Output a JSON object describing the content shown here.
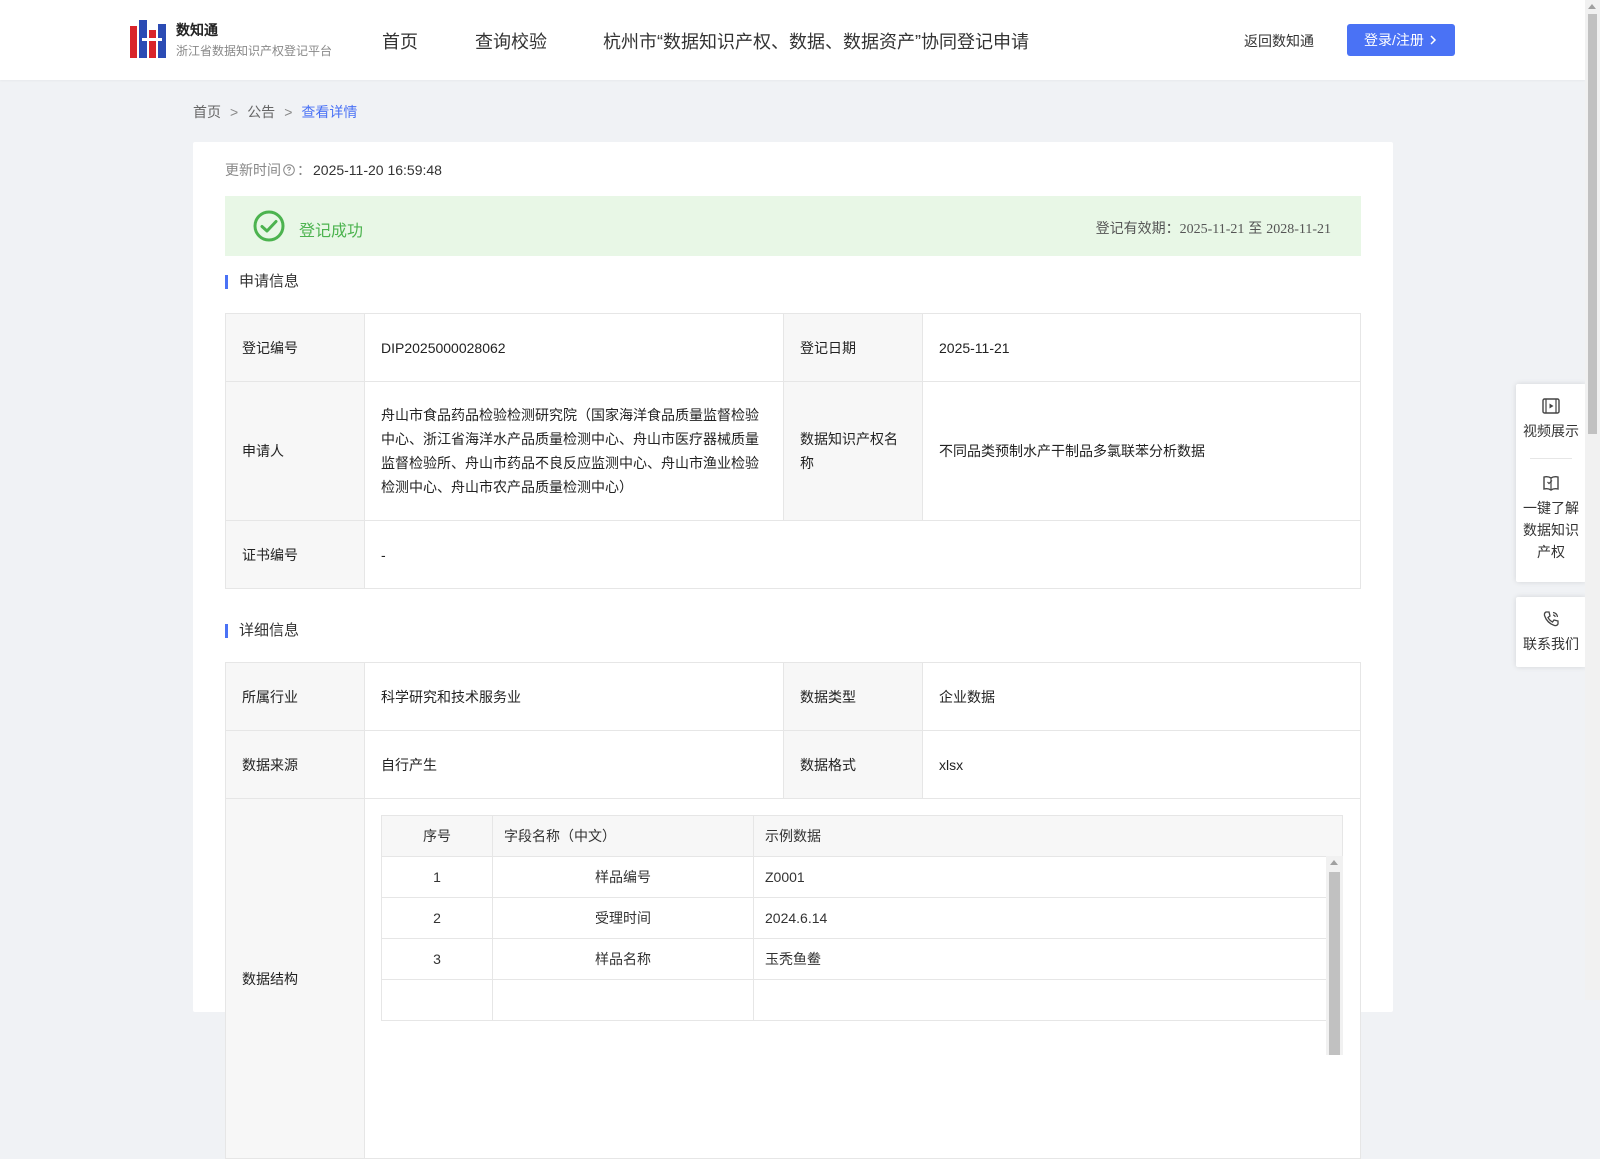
{
  "header": {
    "brand_name": "数知通",
    "brand_sub": "浙江省数据知识产权登记平台",
    "nav": [
      {
        "label": "首页"
      },
      {
        "label": "查询校验"
      },
      {
        "label": "杭州市“数据知识产权、数据、数据资产”协同登记申请"
      }
    ],
    "return_label": "返回数知通",
    "login_label": "登录/注册"
  },
  "breadcrumb": {
    "home": "首页",
    "notice": "公告",
    "current": "查看详情",
    "sep": ">"
  },
  "update": {
    "label": "更新时间",
    "colon": "：",
    "value": "2025-11-20 16:59:48"
  },
  "status": {
    "text": "登记成功",
    "validity_label": "登记有效期：",
    "start": "2025-11-21",
    "to": "至",
    "end": "2028-11-21",
    "color": "#4cb34f"
  },
  "application": {
    "title": "申请信息",
    "reg_no_label": "登记编号",
    "reg_no": "DIP2025000028062",
    "reg_date_label": "登记日期",
    "reg_date": "2025-11-21",
    "applicant_label": "申请人",
    "applicant": "舟山市食品药品检验检测研究院（国家海洋食品质量监督检验中心、浙江省海洋水产品质量检测中心、舟山市医疗器械质量监督检验所、舟山市药品不良反应监测中心、舟山市渔业检验检测中心、舟山市农产品质量检测中心）",
    "ip_name_label": "数据知识产权名称",
    "ip_name": "不同品类预制水产干制品多氯联苯分析数据",
    "cert_no_label": "证书编号",
    "cert_no": "-"
  },
  "details": {
    "title": "详细信息",
    "industry_label": "所属行业",
    "industry": "科学研究和技术服务业",
    "data_type_label": "数据类型",
    "data_type": "企业数据",
    "source_label": "数据来源",
    "source": "自行产生",
    "format_label": "数据格式",
    "format": "xlsx",
    "structure_label": "数据结构",
    "structure": {
      "headers": {
        "idx": "序号",
        "field": "字段名称（中文）",
        "example": "示例数据"
      },
      "rows": [
        {
          "idx": "1",
          "field": "样品编号",
          "example": "Z0001"
        },
        {
          "idx": "2",
          "field": "受理时间",
          "example": "2024.6.14"
        },
        {
          "idx": "3",
          "field": "样品名称",
          "example": "玉秃鱼鲞"
        }
      ]
    }
  },
  "float_panel": {
    "video": "视频展示",
    "learn": [
      "一键了解",
      "数据知识",
      "产权"
    ],
    "contact": "联系我们"
  },
  "colors": {
    "accent": "#4a72f5",
    "success_bg": "#e8f7e6",
    "logo_red": "#d9252b",
    "logo_blue": "#2b4bb4"
  }
}
